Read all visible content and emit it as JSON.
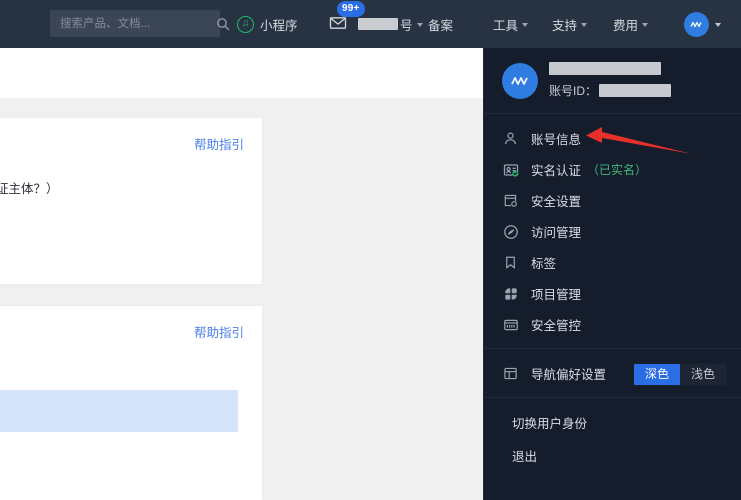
{
  "topnav": {
    "search": {
      "placeholder": "搜索产品、文档...",
      "value": "",
      "icon": "search-icon"
    },
    "mini_program": {
      "label": "小程序",
      "icon": "mini-program-icon"
    },
    "mail": {
      "icon": "mail-icon",
      "badge": "99+"
    },
    "account_nav": {
      "label": "号",
      "redacted": true,
      "has_chevron": true
    },
    "items": [
      {
        "label": "备案",
        "chevron": false
      },
      {
        "label": "工具",
        "chevron": true
      },
      {
        "label": "支持",
        "chevron": true
      },
      {
        "label": "费用",
        "chevron": true
      }
    ],
    "avatar": {
      "icon": "avatar-icon",
      "has_chevron": true
    },
    "bg_color": "#273342"
  },
  "content": {
    "card1": {
      "help_label": "帮助指引",
      "clipped_text": "证主体？）"
    },
    "card2": {
      "help_label": "帮助指引"
    }
  },
  "dropdown": {
    "header": {
      "avatar_icon": "avatar-icon",
      "username_redacted": true,
      "account_id_label": "账号ID：",
      "account_id_value_redacted": true
    },
    "menu": [
      {
        "label": "账号信息",
        "icon": "user-icon",
        "tag": ""
      },
      {
        "label": "实名认证",
        "icon": "id-card-verified-icon",
        "tag": "（已实名）",
        "tag_color": "#3fb87a"
      },
      {
        "label": "安全设置",
        "icon": "lock-settings-icon",
        "tag": ""
      },
      {
        "label": "访问管理",
        "icon": "access-control-icon",
        "tag": ""
      },
      {
        "label": "标签",
        "icon": "bookmark-icon",
        "tag": ""
      },
      {
        "label": "项目管理",
        "icon": "project-grid-icon",
        "tag": ""
      },
      {
        "label": "安全管控",
        "icon": "monitor-shield-icon",
        "tag": ""
      }
    ],
    "preference": {
      "label": "导航偏好设置",
      "icon": "layout-icon",
      "options": [
        {
          "label": "深色",
          "selected": true
        },
        {
          "label": "浅色",
          "selected": false
        }
      ],
      "active_color": "#2b6de5"
    },
    "footer": [
      {
        "label": "切换用户身份"
      },
      {
        "label": "退出"
      }
    ],
    "bg_color": "#151c2b"
  },
  "annotation": {
    "arrow_color": "#e8302b",
    "points_to": "账号信息"
  }
}
